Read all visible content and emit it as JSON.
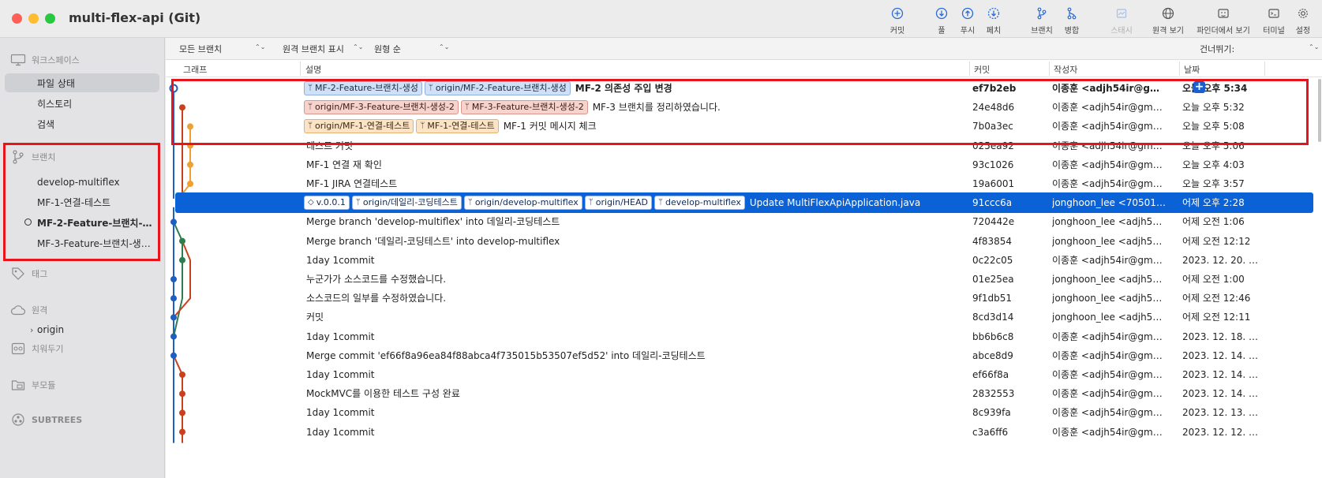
{
  "window": {
    "title": "multi-flex-api (Git)"
  },
  "toolbar": [
    {
      "id": "commit",
      "label": "커밋",
      "icon": "plus-circle-icon"
    },
    {
      "id": "pull",
      "label": "풀",
      "icon": "pull-icon"
    },
    {
      "id": "push",
      "label": "푸시",
      "icon": "push-icon"
    },
    {
      "id": "fetch",
      "label": "페치",
      "icon": "fetch-icon"
    },
    {
      "id": "branch",
      "label": "브랜치",
      "icon": "branch-icon"
    },
    {
      "id": "merge",
      "label": "병합",
      "icon": "merge-icon"
    },
    {
      "id": "stash",
      "label": "스태시",
      "icon": "stash-icon",
      "disabled": true
    },
    {
      "id": "remote",
      "label": "원격 보기",
      "icon": "globe-icon"
    },
    {
      "id": "finder",
      "label": "파인더에서 보기",
      "icon": "finder-icon"
    },
    {
      "id": "terminal",
      "label": "터미널",
      "icon": "terminal-icon"
    },
    {
      "id": "settings",
      "label": "설정",
      "icon": "gear-icon"
    }
  ],
  "sidebar": {
    "workspace": {
      "label": "워크스페이스",
      "items": [
        "파일 상태",
        "히스토리",
        "검색"
      ],
      "selected": "파일 상태"
    },
    "branches": {
      "label": "브랜치",
      "items": [
        "develop-multiflex",
        "MF-1-연결-테스트",
        "MF-2-Feature-브랜치-…",
        "MF-3-Feature-브랜치-생…"
      ],
      "current": "MF-2-Feature-브랜치-…"
    },
    "tags": {
      "label": "태그"
    },
    "remotes": {
      "label": "원격",
      "items": [
        "origin"
      ]
    },
    "stashes": {
      "label": "치워두기"
    },
    "submodules": {
      "label": "부모듈"
    },
    "subtrees": {
      "label": "SUBTREES"
    }
  },
  "filters": {
    "branches": "모든 브랜치",
    "remote": "원격 브랜치 표시",
    "order": "원형 순",
    "skip": "건너뛰기:"
  },
  "columns": {
    "graph": "그래프",
    "description": "설명",
    "commit": "커밋",
    "author": "작성자",
    "date": "날짜"
  },
  "colors": {
    "selection": "#0a62d6",
    "highlight": "#e8141c",
    "lane_blue": "#1f5fbf",
    "lane_red": "#c8401c",
    "lane_orange": "#f0a030",
    "lane_green": "#2e7d4f"
  },
  "commits": [
    {
      "refs": [
        {
          "name": "MF-2-Feature-브랜치-생성",
          "style": "blue"
        },
        {
          "name": "origin/MF-2-Feature-브랜치-생성",
          "style": "blue"
        }
      ],
      "message": "MF-2 의존성 주입 변경",
      "hash": "ef7b2eb",
      "author": "이종훈 <adjh54ir@gmail.…",
      "date": "오늘 오후 5:34",
      "bold": true
    },
    {
      "refs": [
        {
          "name": "origin/MF-3-Feature-브랜치-생성-2",
          "style": "red"
        },
        {
          "name": "MF-3-Feature-브랜치-생성-2",
          "style": "red"
        }
      ],
      "message": "MF-3 브랜치를 정리하였습니다.",
      "hash": "24e48d6",
      "author": "이종훈 <adjh54ir@gmail.co…",
      "date": "오늘 오후 5:32"
    },
    {
      "refs": [
        {
          "name": "origin/MF-1-연결-테스트",
          "style": "orange"
        },
        {
          "name": "MF-1-연결-테스트",
          "style": "orange"
        }
      ],
      "message": "MF-1 커밋 메시지 체크",
      "hash": "7b0a3ec",
      "author": "이종훈 <adjh54ir@gmail.co…",
      "date": "오늘 오후 5:08"
    },
    {
      "refs": [],
      "message": "테스트 커밋",
      "hash": "025ea92",
      "author": "이종훈 <adjh54ir@gmail.co…",
      "date": "오늘 오후 5:06"
    },
    {
      "refs": [],
      "message": "MF-1 연결 재 확인",
      "hash": "93c1026",
      "author": "이종훈 <adjh54ir@gmail.co…",
      "date": "오늘 오후 4:03"
    },
    {
      "refs": [],
      "message": "MF-1 JIRA 연결테스트",
      "hash": "19a6001",
      "author": "이종훈 <adjh54ir@gmail.co…",
      "date": "오늘 오후 3:57"
    },
    {
      "refs": [
        {
          "name": "v.0.0.1",
          "style": "white",
          "kind": "tag"
        },
        {
          "name": "origin/데일리-코딩테스트",
          "style": "white"
        },
        {
          "name": "origin/develop-multiflex",
          "style": "white"
        },
        {
          "name": "origin/HEAD",
          "style": "white"
        },
        {
          "name": "develop-multiflex",
          "style": "white"
        }
      ],
      "message": "Update MultiFlexApiApplication.java",
      "hash": "91ccc6a",
      "author": "jonghoon_lee <70501374…",
      "date": "어제 오후 2:28",
      "selected": true
    },
    {
      "refs": [],
      "message": "Merge branch 'develop-multiflex' into 데일리-코딩테스트",
      "hash": "720442e",
      "author": "jonghoon_lee <adjh54ir@…",
      "date": "어제 오전 1:06"
    },
    {
      "refs": [],
      "message": "Merge branch '데일리-코딩테스트' into develop-multiflex",
      "hash": "4f83854",
      "author": "jonghoon_lee <adjh54ir@…",
      "date": "어제 오전 12:12"
    },
    {
      "refs": [],
      "message": "1day 1commit",
      "hash": "0c22c05",
      "author": "이종훈 <adjh54ir@gmail.co…",
      "date": "2023. 12. 20. 오…"
    },
    {
      "refs": [],
      "message": "누군가가 소스코드를 수정했습니다.",
      "hash": "01e25ea",
      "author": "jonghoon_lee <adjh54ir@…",
      "date": "어제 오전 1:00"
    },
    {
      "refs": [],
      "message": "소스코드의 일부를 수정하였습니다.",
      "hash": "9f1db51",
      "author": "jonghoon_lee <adjh54ir@…",
      "date": "어제 오전 12:46"
    },
    {
      "refs": [],
      "message": "커밋",
      "hash": "8cd3d14",
      "author": "jonghoon_lee <adjh54ir@…",
      "date": "어제 오전 12:11"
    },
    {
      "refs": [],
      "message": "1day 1commit",
      "hash": "bb6b6c8",
      "author": "이종훈 <adjh54ir@gmail.co…",
      "date": "2023. 12. 18. 오…"
    },
    {
      "refs": [],
      "message": "Merge commit 'ef66f8a96ea84f88abca4f735015b53507ef5d52' into 데일리-코딩테스트",
      "hash": "abce8d9",
      "author": "이종훈 <adjh54ir@gmail.co…",
      "date": "2023. 12. 14. 오…"
    },
    {
      "refs": [],
      "message": "1day 1commit",
      "hash": "ef66f8a",
      "author": "이종훈 <adjh54ir@gmail.co…",
      "date": "2023. 12. 14. 오…"
    },
    {
      "refs": [],
      "message": "MockMVC를 이용한 테스트 구성 완료",
      "hash": "2832553",
      "author": "이종훈 <adjh54ir@gmail.co…",
      "date": "2023. 12. 14. 오…"
    },
    {
      "refs": [],
      "message": "1day 1commit",
      "hash": "8c939fa",
      "author": "이종훈 <adjh54ir@gmail.co…",
      "date": "2023. 12. 13. 오…"
    },
    {
      "refs": [],
      "message": "1day 1commit",
      "hash": "c3a6ff6",
      "author": "이종훈 <adjh54ir@gmail.co…",
      "date": "2023. 12. 12. 오…"
    }
  ]
}
